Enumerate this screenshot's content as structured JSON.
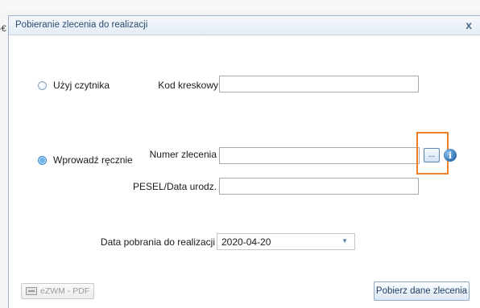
{
  "background": {
    "fragment_text": "-€"
  },
  "dialog": {
    "title": "Pobieranie zlecenia do realizacji",
    "close_label": "x"
  },
  "mode": {
    "reader_label": "Użyj czytnika",
    "manual_label": "Wprowadź ręcznie",
    "selected": "manual"
  },
  "fields": {
    "barcode_label": "Kod kreskowy",
    "barcode_value": "",
    "order_number_label": "Numer zlecenia",
    "order_number_value": "",
    "browse_label": "...",
    "info_label": "i",
    "pesel_label": "PESEL/Data urodz.",
    "pesel_value": ""
  },
  "date": {
    "label": "Data pobrania do realizacji",
    "value": "2020-04-20",
    "dropdown_arrow": "▼"
  },
  "footer": {
    "pdf_button_label": "eZWM - PDF",
    "fetch_button_label": "Pobierz dane zlecenia"
  },
  "colors": {
    "highlight": "#f07f2a",
    "title_text": "#2b4a6f",
    "accent": "#3c86c9"
  }
}
